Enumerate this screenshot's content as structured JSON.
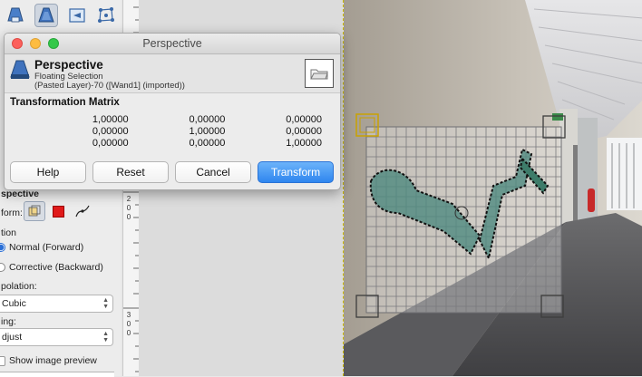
{
  "toolbar": {
    "tools": [
      {
        "icon": "perspective-icon"
      },
      {
        "icon": "perspective-tool-icon"
      },
      {
        "icon": "flip-icon"
      },
      {
        "icon": "cage-transform-icon"
      }
    ]
  },
  "tool_options": {
    "section_title": "spective",
    "transform_label": "form:",
    "direction_label": "tion",
    "normal_label": "Normal (Forward)",
    "corrective_label": "Corrective (Backward)",
    "interpolation_label": "polation:",
    "interpolation_value": "Cubic",
    "clipping_label": "ing:",
    "clipping_value": "djust",
    "preview_label": "Show image preview"
  },
  "ruler": {
    "marks": [
      "2",
      "0",
      "0",
      "3",
      "0",
      "0"
    ]
  },
  "dialog": {
    "window_title": "Perspective",
    "header_title": "Perspective",
    "subtitle_1": "Floating Selection",
    "subtitle_2": "(Pasted Layer)-70 ([Wand1] (imported))",
    "matrix_title": "Transformation Matrix",
    "matrix": [
      [
        "1,00000",
        "0,00000",
        "0,00000"
      ],
      [
        "0,00000",
        "1,00000",
        "0,00000"
      ],
      [
        "0,00000",
        "0,00000",
        "1,00000"
      ]
    ],
    "buttons": {
      "help": "Help",
      "reset": "Reset",
      "cancel": "Cancel",
      "transform": "Transform"
    }
  },
  "colors": {
    "accent": "#2f86ef",
    "close_light": "#fc605c",
    "minimize_light": "#fdbc40",
    "zoom_light": "#34c84a",
    "handle_active": "#c9a200"
  }
}
